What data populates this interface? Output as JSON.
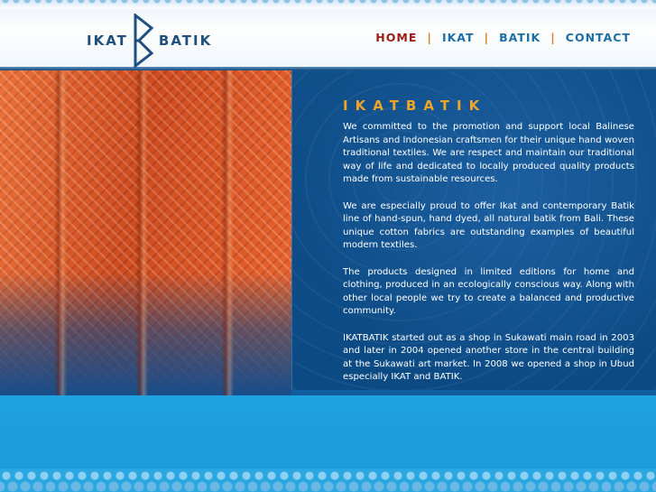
{
  "logo": {
    "left_word": "IKAT",
    "right_word": "BATIK"
  },
  "nav": {
    "items": [
      {
        "label": "HOME"
      },
      {
        "label": "IKAT"
      },
      {
        "label": "BATIK"
      },
      {
        "label": "CONTACT"
      }
    ],
    "separator": "|"
  },
  "content": {
    "title": "IKATBATIK",
    "paragraphs": [
      "We committed to the promotion and support local Balinese Artisans and Indonesian craftsmen for their unique hand woven traditional textiles. We are respect and maintain our traditional way of life and dedicated to locally produced quality products made from sustainable resources.",
      "We are especially proud to offer Ikat and contemporary Batik line of hand-spun, hand dyed, all natural batik from Bali. These unique cotton fabrics are outstanding examples of beautiful modern textiles.",
      "The products designed in limited editions for home and clothing, produced in an ecologically conscious way. Along with other local people we try to create a balanced and productive community.",
      "IKATBATIK started out as a shop in Sukawati main road in 2003 and later in 2004 opened another store in the central building at the Sukawati art market. In 2008 we opened a shop in Ubud especially IKAT and BATIK."
    ]
  },
  "colors": {
    "nav_active": "#9c1b14",
    "nav_link": "#1b6ea8",
    "separator": "#e07b20",
    "title": "#f0a527",
    "panel": "#0f4f8a"
  }
}
